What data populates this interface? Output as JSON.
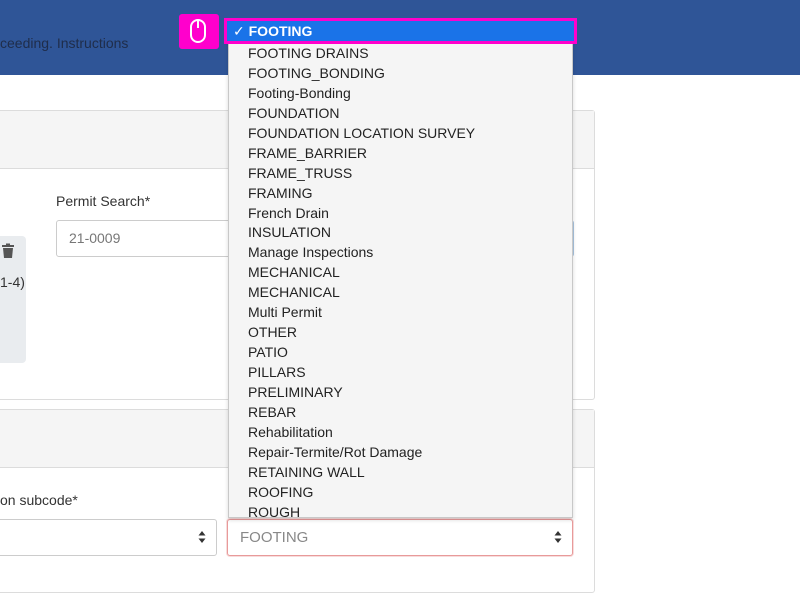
{
  "topbar": {
    "text": "ceeding. Instructions"
  },
  "permit_search": {
    "label": "Permit Search*",
    "placeholder": "21-0009"
  },
  "card": {
    "text": "1-4)"
  },
  "inspection": {
    "subcode_label": "on subcode*"
  },
  "inspection_type": {
    "value": "FOOTING"
  },
  "dropdown": {
    "selected": "FOOTING",
    "checkmark": "✓",
    "options": [
      "FOOTING DRAINS",
      "FOOTING_BONDING",
      "Footing-Bonding",
      "FOUNDATION",
      "FOUNDATION LOCATION SURVEY",
      "FRAME_BARRIER",
      "FRAME_TRUSS",
      "FRAMING",
      "French Drain",
      "INSULATION",
      "Manage Inspections",
      "MECHANICAL",
      "MECHANICAL",
      "Multi Permit",
      "OTHER",
      "PATIO",
      "PILLARS",
      "PRELIMINARY",
      "REBAR",
      "Rehabilitation",
      "Repair-Termite/Rot Damage",
      "RETAINING WALL",
      "ROOFING",
      "ROUGH"
    ]
  },
  "colors": {
    "topbar": "#2f5597",
    "highlight": "#ff00cc",
    "selected_bg": "#1a73e8"
  }
}
